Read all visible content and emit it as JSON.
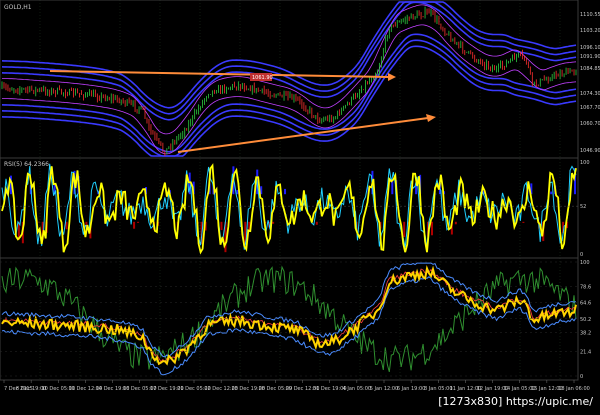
{
  "app": {
    "watermark": "[1273x830] https://upic.me/"
  },
  "colors": {
    "background": "#000000",
    "grid": "#1e3a1e",
    "candle_up": "#2ecc40",
    "candle_down": "#ff3030",
    "band_blue": "#3a3aff",
    "band_purple": "#c040ff",
    "trend_arrow": "#ff8c3a",
    "rsi_yellow": "#ffff00",
    "rsi_cyan": "#20d0ff",
    "rsi_blue_fill": "#2020ff",
    "rsi_red_fill": "#b00000",
    "osc_yellow": "#ffd400",
    "osc_green": "#2f8f2f",
    "osc_blue": "#4a8cff",
    "osc_red": "#ff4040",
    "text": "#c8c8c8"
  },
  "panels": [
    {
      "id": "price",
      "title": "GOLD,H1",
      "y_ticks": [
        "1110.55",
        "1103.20",
        "1096.10",
        "1091.90",
        "1084.85",
        "1074.30",
        "1067.70",
        "1060.70",
        "1046.90"
      ],
      "price_label": "1061.90"
    },
    {
      "id": "rsi",
      "title": "RSI(5) 64.2366",
      "y_ticks": [
        "100",
        "52",
        "0"
      ]
    },
    {
      "id": "oscillator",
      "title": "",
      "y_ticks": [
        "100",
        "78.6",
        "64.6",
        "50.2",
        "38.2",
        "21.4",
        "0"
      ]
    }
  ],
  "x_axis": {
    "labels": [
      "7 Dec 2015",
      "8 Dec 19:00",
      "10 Dec 05:00",
      "11 Dec 12:00",
      "14 Dec 19:00",
      "16 Dec 05:00",
      "17 Dec 19:00",
      "21 Dec 05:00",
      "22 Dec 12:00",
      "23 Dec 19:00",
      "28 Dec 05:00",
      "29 Dec 12:00",
      "31 Dec 19:00",
      "4 Jan 05:00",
      "5 Jan 12:00",
      "6 Jan 19:00",
      "8 Jan 05:00",
      "11 Jan 12:00",
      "12 Jan 19:00",
      "14 Jan 05:00",
      "15 Jan 12:00",
      "18 Jan 06:00"
    ]
  }
}
